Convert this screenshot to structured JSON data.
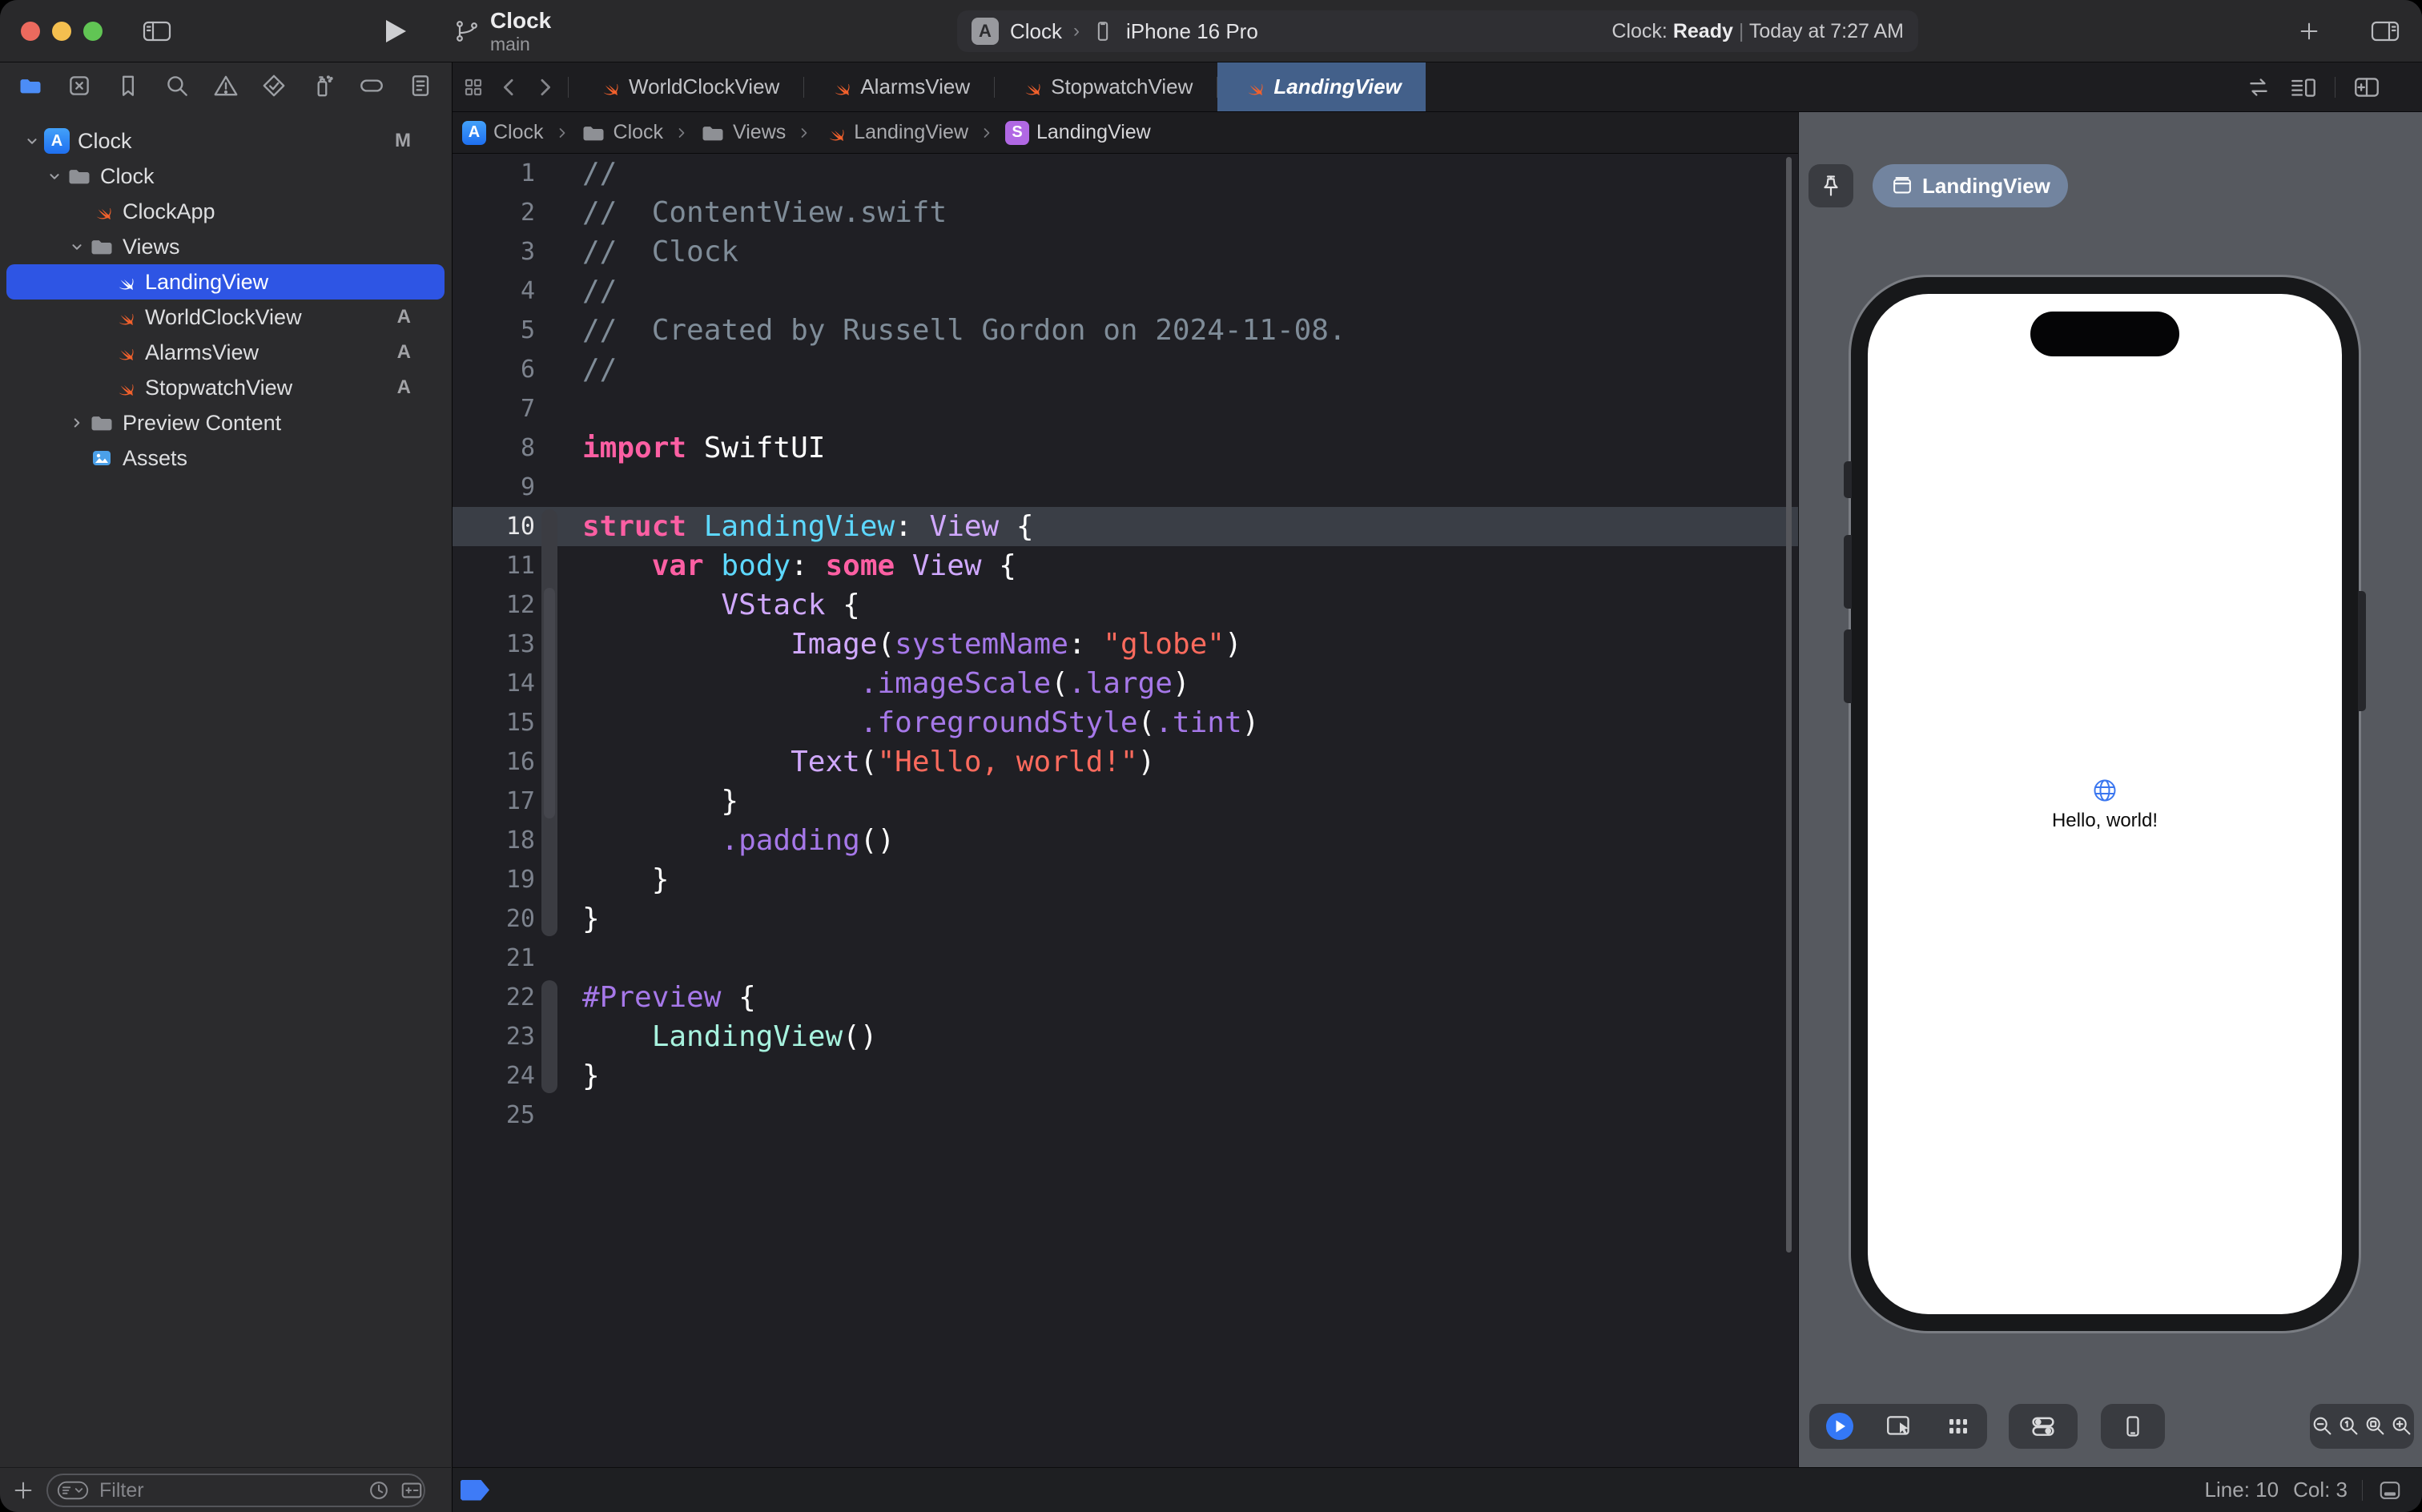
{
  "titlebar": {
    "project": "Clock",
    "branch": "main",
    "scheme": "Clock",
    "run_destination": "iPhone 16 Pro",
    "status_app": "Clock: ",
    "status_state": "Ready",
    "status_separator": " | ",
    "status_time": "Today at 7:27 AM"
  },
  "badges": {
    "app": "A",
    "struct": "S"
  },
  "navigator": {
    "tabs": [
      "project",
      "source-control",
      "bookmarks",
      "find",
      "issues",
      "tests",
      "debug",
      "breakpoints",
      "reports"
    ],
    "active_tab": "project",
    "tree": [
      {
        "label": "Clock",
        "icon": "app",
        "level": 0,
        "chevron": "down",
        "badge": "M",
        "selected": false
      },
      {
        "label": "Clock",
        "icon": "folder",
        "level": 1,
        "chevron": "down",
        "badge": "",
        "selected": false
      },
      {
        "label": "ClockApp",
        "icon": "swift",
        "level": 2,
        "chevron": "",
        "badge": "",
        "selected": false
      },
      {
        "label": "Views",
        "icon": "folder",
        "level": 2,
        "chevron": "down",
        "badge": "",
        "selected": false
      },
      {
        "label": "LandingView",
        "icon": "swift",
        "level": 3,
        "chevron": "",
        "badge": "",
        "selected": true
      },
      {
        "label": "WorldClockView",
        "icon": "swift",
        "level": 3,
        "chevron": "",
        "badge": "A",
        "selected": false
      },
      {
        "label": "AlarmsView",
        "icon": "swift",
        "level": 3,
        "chevron": "",
        "badge": "A",
        "selected": false
      },
      {
        "label": "StopwatchView",
        "icon": "swift",
        "level": 3,
        "chevron": "",
        "badge": "A",
        "selected": false
      },
      {
        "label": "Preview Content",
        "icon": "folder",
        "level": 2,
        "chevron": "right",
        "badge": "",
        "selected": false
      },
      {
        "label": "Assets",
        "icon": "assets",
        "level": 2,
        "chevron": "",
        "badge": "",
        "selected": false
      }
    ],
    "filter_placeholder": "Filter"
  },
  "editor_tabs": [
    {
      "label": "WorldClockView",
      "active": false
    },
    {
      "label": "AlarmsView",
      "active": false
    },
    {
      "label": "StopwatchView",
      "active": false
    },
    {
      "label": "LandingView",
      "active": true
    }
  ],
  "breadcrumb": [
    {
      "label": "Clock",
      "icon": "app"
    },
    {
      "label": "Clock",
      "icon": "folder"
    },
    {
      "label": "Views",
      "icon": "folder"
    },
    {
      "label": "LandingView",
      "icon": "swift"
    },
    {
      "label": "LandingView",
      "icon": "struct"
    }
  ],
  "code": {
    "highlight_line": 10,
    "lines": [
      {
        "n": 1,
        "t": [
          [
            "com",
            "//"
          ]
        ]
      },
      {
        "n": 2,
        "t": [
          [
            "com",
            "//  ContentView.swift"
          ]
        ]
      },
      {
        "n": 3,
        "t": [
          [
            "com",
            "//  Clock"
          ]
        ]
      },
      {
        "n": 4,
        "t": [
          [
            "com",
            "//"
          ]
        ]
      },
      {
        "n": 5,
        "t": [
          [
            "com",
            "//  Created by Russell Gordon on 2024-11-08."
          ]
        ]
      },
      {
        "n": 6,
        "t": [
          [
            "com",
            "//"
          ]
        ]
      },
      {
        "n": 7,
        "t": []
      },
      {
        "n": 8,
        "t": [
          [
            "kw",
            "import"
          ],
          [
            "pl",
            " SwiftUI"
          ]
        ]
      },
      {
        "n": 9,
        "t": []
      },
      {
        "n": 10,
        "t": [
          [
            "kw",
            "struct"
          ],
          [
            "pl",
            " "
          ],
          [
            "decl",
            "LandingView"
          ],
          [
            "pl",
            ": "
          ],
          [
            "type",
            "View"
          ],
          [
            "pl",
            " {"
          ]
        ]
      },
      {
        "n": 11,
        "t": [
          [
            "pl",
            "    "
          ],
          [
            "kw",
            "var"
          ],
          [
            "pl",
            " "
          ],
          [
            "decl",
            "body"
          ],
          [
            "pl",
            ": "
          ],
          [
            "kw",
            "some"
          ],
          [
            "pl",
            " "
          ],
          [
            "type",
            "View"
          ],
          [
            "pl",
            " {"
          ]
        ]
      },
      {
        "n": 12,
        "t": [
          [
            "pl",
            "        "
          ],
          [
            "type",
            "VStack"
          ],
          [
            "pl",
            " {"
          ]
        ]
      },
      {
        "n": 13,
        "t": [
          [
            "pl",
            "            "
          ],
          [
            "type",
            "Image"
          ],
          [
            "pl",
            "("
          ],
          [
            "mem",
            "systemName"
          ],
          [
            "pl",
            ": "
          ],
          [
            "str",
            "\"globe\""
          ],
          [
            "pl",
            ")"
          ]
        ]
      },
      {
        "n": 14,
        "t": [
          [
            "pl",
            "                "
          ],
          [
            "mem",
            ".imageScale"
          ],
          [
            "pl",
            "("
          ],
          [
            "mem",
            ".large"
          ],
          [
            "pl",
            ")"
          ]
        ]
      },
      {
        "n": 15,
        "t": [
          [
            "pl",
            "                "
          ],
          [
            "mem",
            ".foregroundStyle"
          ],
          [
            "pl",
            "("
          ],
          [
            "mem",
            ".tint"
          ],
          [
            "pl",
            ")"
          ]
        ]
      },
      {
        "n": 16,
        "t": [
          [
            "pl",
            "            "
          ],
          [
            "type",
            "Text"
          ],
          [
            "pl",
            "("
          ],
          [
            "str",
            "\"Hello, world!\""
          ],
          [
            "pl",
            ")"
          ]
        ]
      },
      {
        "n": 17,
        "t": [
          [
            "pl",
            "        }"
          ]
        ]
      },
      {
        "n": 18,
        "t": [
          [
            "pl",
            "        "
          ],
          [
            "mem",
            ".padding"
          ],
          [
            "pl",
            "()"
          ]
        ]
      },
      {
        "n": 19,
        "t": [
          [
            "pl",
            "    }"
          ]
        ]
      },
      {
        "n": 20,
        "t": [
          [
            "pl",
            "}"
          ]
        ]
      },
      {
        "n": 21,
        "t": []
      },
      {
        "n": 22,
        "t": [
          [
            "mem",
            "#Preview"
          ],
          [
            "pl",
            " {"
          ]
        ]
      },
      {
        "n": 23,
        "t": [
          [
            "pl",
            "    "
          ],
          [
            "proj",
            "LandingView"
          ],
          [
            "pl",
            "()"
          ]
        ]
      },
      {
        "n": 24,
        "t": [
          [
            "pl",
            "}"
          ]
        ]
      },
      {
        "n": 25,
        "t": []
      }
    ]
  },
  "preview": {
    "pin_label": "LandingView",
    "canvas_text": "Hello, world!",
    "controls_left": [
      "live-preview",
      "selectable-mode",
      "variants-mode"
    ],
    "controls_device": [
      "device-settings",
      "device"
    ],
    "controls_zoom": [
      "zoom-out",
      "zoom-actual",
      "zoom-fit",
      "zoom-in"
    ]
  },
  "status_bar": {
    "line": "Line: 10",
    "col": "Col: 3"
  },
  "colors": {
    "accent": "#2E55E4",
    "swift_orange": "#F3612C",
    "tint_blue": "#3478F6",
    "active_tab": "#43608A"
  }
}
